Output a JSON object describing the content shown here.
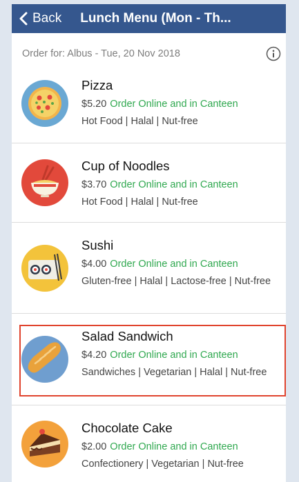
{
  "nav": {
    "back_label": "Back",
    "title": "Lunch Menu (Mon - Th..."
  },
  "order_for": {
    "text": "Order for: Albus - Tue, 20 Nov 2018"
  },
  "items": [
    {
      "name": "Pizza",
      "price": "$5.20",
      "availability": "Order Online and in Canteen",
      "tags": "Hot Food | Halal | Nut-free",
      "icon": "pizza-icon"
    },
    {
      "name": "Cup of Noodles",
      "price": "$3.70",
      "availability": "Order Online and in Canteen",
      "tags": "Hot Food | Halal | Nut-free",
      "icon": "noodles-icon"
    },
    {
      "name": "Sushi",
      "price": "$4.00",
      "availability": "Order Online and in Canteen",
      "tags": "Gluten-free | Halal | Lactose-free | Nut-free",
      "icon": "sushi-icon"
    },
    {
      "name": "Salad Sandwich",
      "price": "$4.20",
      "availability": "Order Online and in Canteen",
      "tags": "Sandwiches | Vegetarian | Halal | Nut-free",
      "icon": "bread-icon"
    },
    {
      "name": "Chocolate Cake",
      "price": "$2.00",
      "availability": "Order Online and in Canteen",
      "tags": "Confectionery | Vegetarian | Nut-free",
      "icon": "cake-icon"
    }
  ],
  "colors": {
    "navbar": "#35578e",
    "available": "#2fa84f",
    "highlight": "#e0432d"
  }
}
